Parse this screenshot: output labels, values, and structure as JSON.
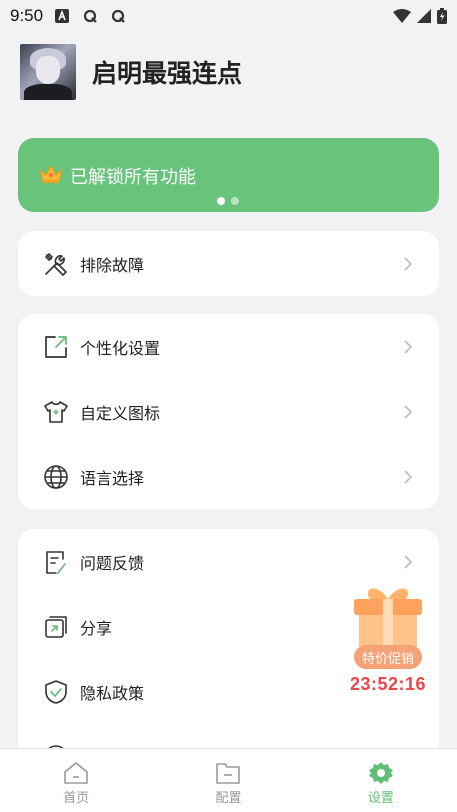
{
  "status_bar": {
    "time": "9:50",
    "icons": [
      "a-notification-icon",
      "q-notification-icon",
      "q-notification-icon",
      "wifi-icon",
      "signal-icon",
      "battery-icon"
    ]
  },
  "profile": {
    "username": "启明最强连点"
  },
  "banner": {
    "text": "已解锁所有功能",
    "page_count": 2,
    "active_page": 1,
    "color": "#67c47a"
  },
  "groups": [
    {
      "items": [
        {
          "label": "排除故障",
          "icon": "tools-icon"
        }
      ]
    },
    {
      "items": [
        {
          "label": "个性化设置",
          "icon": "external-link-icon"
        },
        {
          "label": "自定义图标",
          "icon": "tshirt-icon"
        },
        {
          "label": "语言选择",
          "icon": "globe-icon"
        }
      ]
    },
    {
      "items": [
        {
          "label": "问题反馈",
          "icon": "feedback-icon"
        },
        {
          "label": "分享",
          "icon": "share-link-icon"
        },
        {
          "label": "隐私政策",
          "icon": "shield-check-icon"
        }
      ]
    }
  ],
  "promo": {
    "tag": "特价促销",
    "timer": "23:52:16"
  },
  "tabbar": {
    "tabs": [
      {
        "label": "首页",
        "icon": "home-icon",
        "active": false
      },
      {
        "label": "配置",
        "icon": "folder-icon",
        "active": false
      },
      {
        "label": "设置",
        "icon": "gear-icon",
        "active": true
      }
    ],
    "active_color": "#5fbf74"
  }
}
